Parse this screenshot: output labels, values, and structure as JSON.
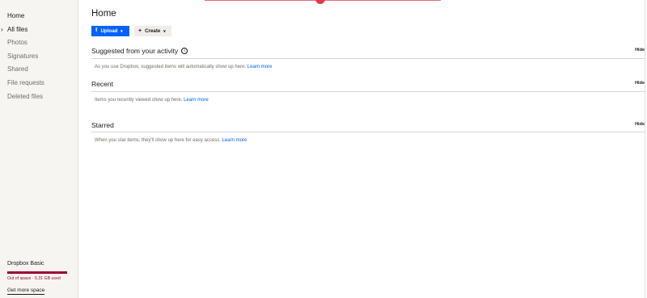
{
  "sidebar": {
    "items": [
      {
        "label": "Home"
      },
      {
        "label": "All files"
      },
      {
        "label": "Photos"
      },
      {
        "label": "Signatures"
      },
      {
        "label": "Shared"
      },
      {
        "label": "File requests"
      },
      {
        "label": "Deleted files"
      }
    ],
    "plan": {
      "name": "Dropbox Basic",
      "usage_text": "Out of space · 5.31 GB used",
      "usage_fraction": 1.0,
      "upgrade_label": "Get more space"
    }
  },
  "main": {
    "title": "Home",
    "upload_label": "Upload",
    "create_label": "Create",
    "sections": [
      {
        "title": "Suggested from your activity",
        "hide_label": "Hide",
        "body": "As you use Dropbox, suggested items will automatically show up here.",
        "link": "Learn more"
      },
      {
        "title": "Recent",
        "hide_label": "Hide",
        "body": "Items you recently viewed show up here.",
        "link": "Learn more"
      },
      {
        "title": "Starred",
        "hide_label": "Hide",
        "body": "When you star items, they'll show up here for easy access.",
        "link": "Learn more"
      }
    ]
  },
  "colors": {
    "accent": "#0061fe",
    "warning": "#9b0032",
    "sidebar_bg": "#f7f5f2"
  },
  "icons": {
    "upload": "upload-icon",
    "create": "plus-icon",
    "info": "info-icon",
    "expand": "chevron-right-icon"
  }
}
